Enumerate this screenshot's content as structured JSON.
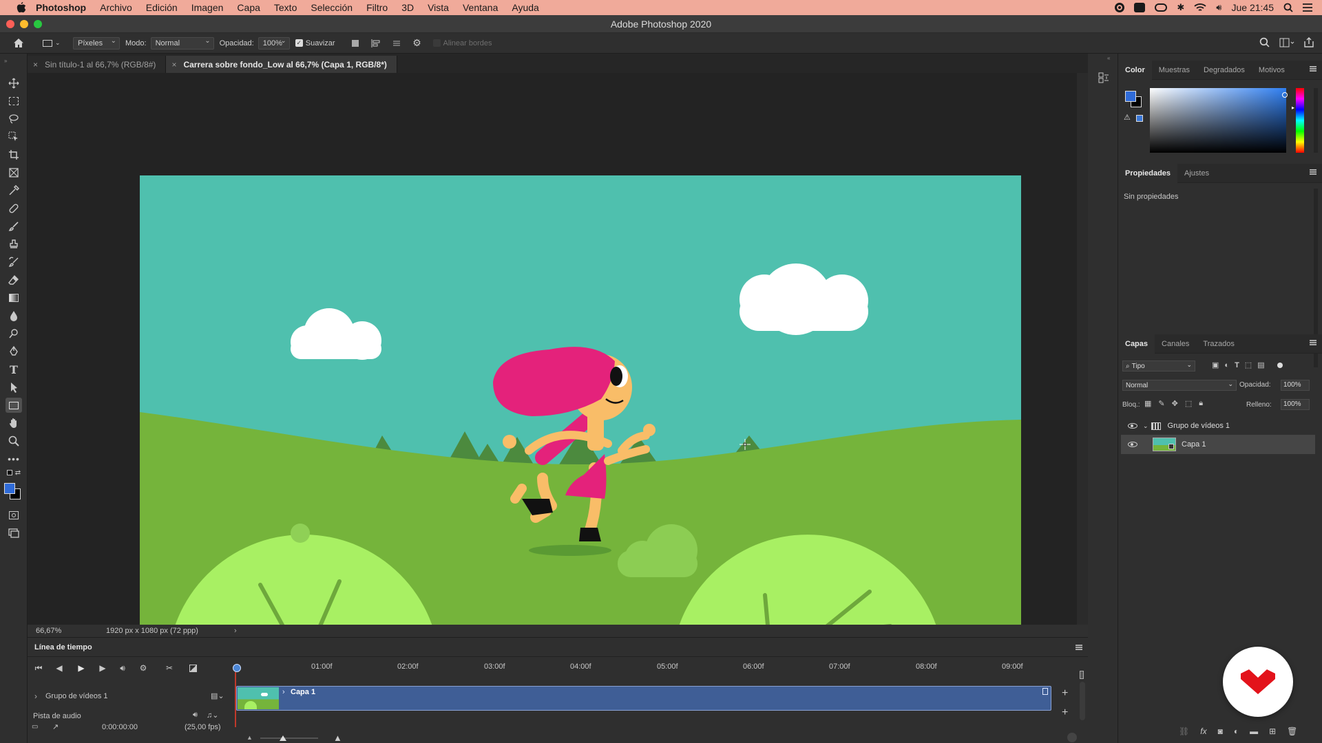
{
  "menubar": {
    "app_name": "Photoshop",
    "items": [
      "Archivo",
      "Edición",
      "Imagen",
      "Capa",
      "Texto",
      "Selección",
      "Filtro",
      "3D",
      "Vista",
      "Ventana",
      "Ayuda"
    ],
    "clock": "Jue 21:45"
  },
  "window": {
    "title": "Adobe Photoshop 2020"
  },
  "options_bar": {
    "units_value": "Píxeles",
    "mode_label": "Modo:",
    "mode_value": "Normal",
    "opacity_label": "Opacidad:",
    "opacity_value": "100%",
    "smooth_label": "Suavizar",
    "align_edges_label": "Alinear bordes"
  },
  "tabs": [
    {
      "label": "Sin título-1 al 66,7% (RGB/8#)",
      "active": false
    },
    {
      "label": "Carrera sobre fondo_Low al 66,7% (Capa 1, RGB/8*)",
      "active": true
    }
  ],
  "status": {
    "zoom": "66,67%",
    "doc_info": "1920 px x 1080 px (72 ppp)"
  },
  "timeline": {
    "title": "Línea de tiempo",
    "ticks": [
      "01:00f",
      "02:00f",
      "03:00f",
      "04:00f",
      "05:00f",
      "06:00f",
      "07:00f",
      "08:00f",
      "09:00f"
    ],
    "group_track": "Grupo de vídeos 1",
    "clip_label": "Capa 1",
    "audio_track": "Pista de audio",
    "timecode": "0:00:00:00",
    "fps": "(25,00 fps)"
  },
  "color_panel": {
    "tabs": [
      "Color",
      "Muestras",
      "Degradados",
      "Motivos"
    ],
    "foreground": "#2f6bd8",
    "background": "#000000"
  },
  "properties_panel": {
    "tabs": [
      "Propiedades",
      "Ajustes"
    ],
    "empty_text": "Sin propiedades"
  },
  "layers_panel": {
    "tabs": [
      "Capas",
      "Canales",
      "Trazados"
    ],
    "filter_value": "Tipo",
    "blend_mode": "Normal",
    "opacity_label": "Opacidad:",
    "opacity_value": "100%",
    "lock_label": "Bloq.:",
    "fill_label": "Relleno:",
    "fill_value": "100%",
    "layers": [
      {
        "name": "Grupo de vídeos 1",
        "type": "group"
      },
      {
        "name": "Capa 1",
        "type": "video"
      }
    ]
  }
}
